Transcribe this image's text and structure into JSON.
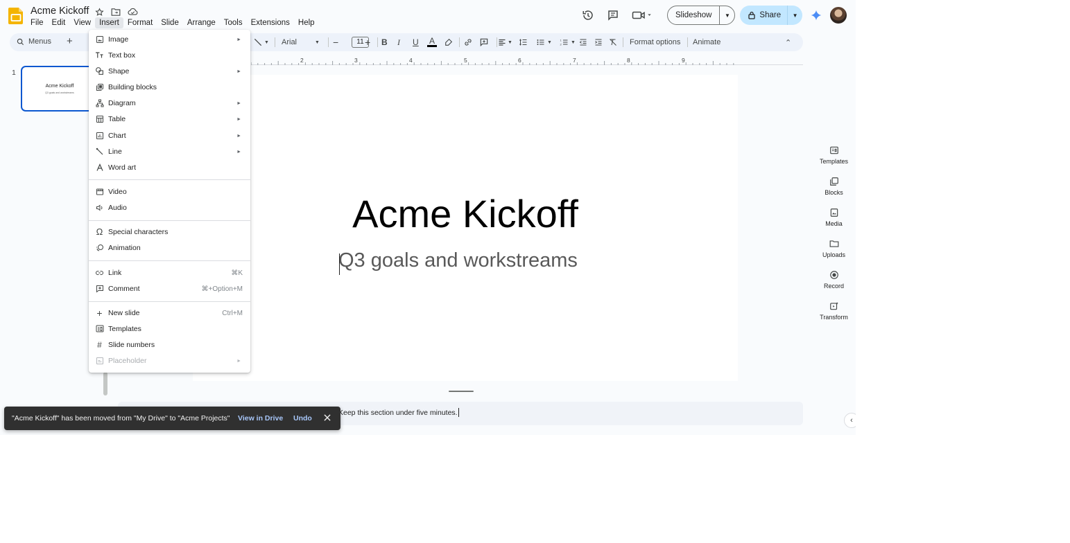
{
  "document": {
    "title": "Acme Kickoff"
  },
  "menubar": [
    "File",
    "Edit",
    "View",
    "Insert",
    "Format",
    "Slide",
    "Arrange",
    "Tools",
    "Extensions",
    "Help"
  ],
  "header": {
    "slideshow_label": "Slideshow",
    "share_label": "Share"
  },
  "toolbar": {
    "menus_label": "Menus",
    "font_name": "Arial",
    "font_size": "11",
    "format_options": "Format options",
    "animate": "Animate"
  },
  "filmstrip": {
    "slide_number": "1",
    "thumb_title": "Acme Kickoff",
    "thumb_subtitle": "Q3 goals and workstreams"
  },
  "ruler": [
    "2",
    "3",
    "4",
    "5",
    "6",
    "7",
    "8",
    "9"
  ],
  "slide": {
    "title": "Acme Kickoff",
    "subtitle": "Q3 goals and workstreams"
  },
  "notes": {
    "text": "Keep this section under five minutes."
  },
  "side_panel": [
    "Templates",
    "Blocks",
    "Media",
    "Uploads",
    "Record",
    "Transform"
  ],
  "insert_menu": {
    "items": [
      {
        "label": "Image",
        "icon": "image-icon",
        "submenu": true
      },
      {
        "label": "Text box",
        "icon": "text-box-icon"
      },
      {
        "label": "Shape",
        "icon": "shape-icon",
        "submenu": true
      },
      {
        "label": "Building blocks",
        "icon": "building-blocks-icon"
      },
      {
        "label": "Diagram",
        "icon": "diagram-icon",
        "submenu": true
      },
      {
        "label": "Table",
        "icon": "table-icon",
        "submenu": true
      },
      {
        "label": "Chart",
        "icon": "chart-icon",
        "submenu": true
      },
      {
        "label": "Line",
        "icon": "line-icon",
        "submenu": true
      },
      {
        "label": "Word art",
        "icon": "word-art-icon"
      },
      {
        "label": "Video",
        "icon": "video-icon"
      },
      {
        "label": "Audio",
        "icon": "audio-icon"
      },
      {
        "label": "Special characters",
        "icon": "omega-icon"
      },
      {
        "label": "Animation",
        "icon": "animation-icon"
      },
      {
        "label": "Link",
        "icon": "link-icon",
        "shortcut": "⌘K"
      },
      {
        "label": "Comment",
        "icon": "comment-icon",
        "shortcut": "⌘+Option+M"
      },
      {
        "label": "New slide",
        "icon": "plus-icon",
        "shortcut": "Ctrl+M"
      },
      {
        "label": "Templates",
        "icon": "templates-icon"
      },
      {
        "label": "Slide numbers",
        "icon": "hash-icon"
      },
      {
        "label": "Placeholder",
        "icon": "placeholder-icon",
        "submenu": true,
        "disabled": true
      }
    ]
  },
  "snackbar": {
    "message": "\"Acme Kickoff\" has been moved from \"My Drive\" to \"Acme Projects\"",
    "view_label": "View in Drive",
    "undo_label": "Undo"
  },
  "colors": {
    "accent": "#0b57d0",
    "share_bg": "#c2e7ff",
    "toolbar_bg": "#edf2fa",
    "app_bg": "#f9fbfd",
    "snackbar_bg": "#303030",
    "snackbar_link": "#a8c7fa",
    "logo": "#f4b400"
  }
}
